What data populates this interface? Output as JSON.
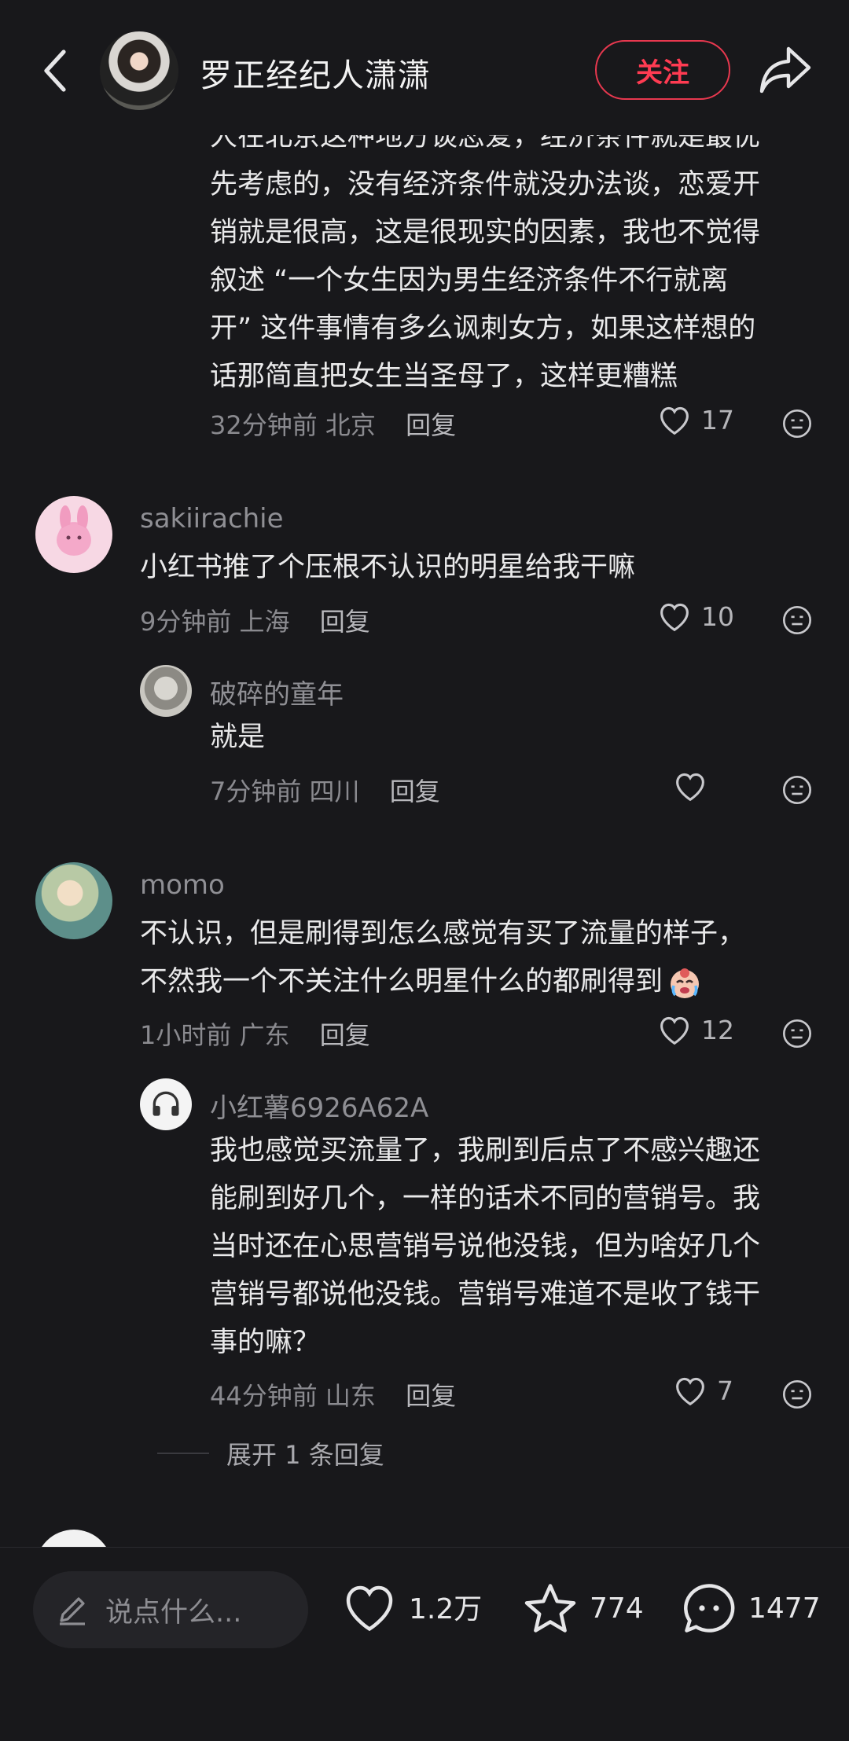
{
  "header": {
    "title": "罗正经纪人潇潇",
    "follow_label": "关注"
  },
  "comments": [
    {
      "lines": [
        "人在北京这种地方谈恋爱，经济条件就是最优",
        "先考虑的，没有经济条件就没办法谈，恋爱开",
        "销就是很高，这是很现实的因素，我也不觉得",
        "叙述 “一个女生因为男生经济条件不行就离",
        "开” 这件事情有多么讽刺女方，如果这样想的",
        "话那简直把女生当圣母了，这样更糟糕"
      ],
      "time": "32分钟前",
      "location": "北京",
      "reply_label": "回复",
      "likes": "17"
    },
    {
      "username": "sakiirachie",
      "text": "小红书推了个压根不认识的明星给我干嘛",
      "time": "9分钟前",
      "location": "上海",
      "reply_label": "回复",
      "likes": "10",
      "reply": {
        "username": "破碎的童年",
        "text": "就是",
        "time": "7分钟前",
        "location": "四川",
        "reply_label": "回复",
        "likes": ""
      }
    },
    {
      "username": "momo",
      "lines": [
        "不认识，但是刷得到怎么感觉有买了流量的样子，",
        "不然我一个不关注什么明星什么的都刷得到"
      ],
      "time": "1小时前",
      "location": "广东",
      "reply_label": "回复",
      "likes": "12",
      "reply": {
        "username": "小红薯6926A62A",
        "lines": [
          "我也感觉买流量了，我刷到后点了不感兴趣还",
          "能刷到好几个，一样的话术不同的营销号。我",
          "当时还在心思营销号说他没钱，但为啥好几个",
          "营销号都说他没钱。营销号难道不是收了钱干",
          "事的嘛？"
        ],
        "time": "44分钟前",
        "location": "山东",
        "reply_label": "回复",
        "likes": "7"
      },
      "expand_label": "展开 1 条回复"
    }
  ],
  "bottom_bar": {
    "input_placeholder": "说点什么...",
    "likes": "1.2万",
    "favorites": "774",
    "comments": "1477"
  },
  "colors": {
    "background": "#18181b",
    "accent": "#ff3b52",
    "text_primary": "#e9e9ea",
    "text_secondary": "#8a8a8f"
  }
}
